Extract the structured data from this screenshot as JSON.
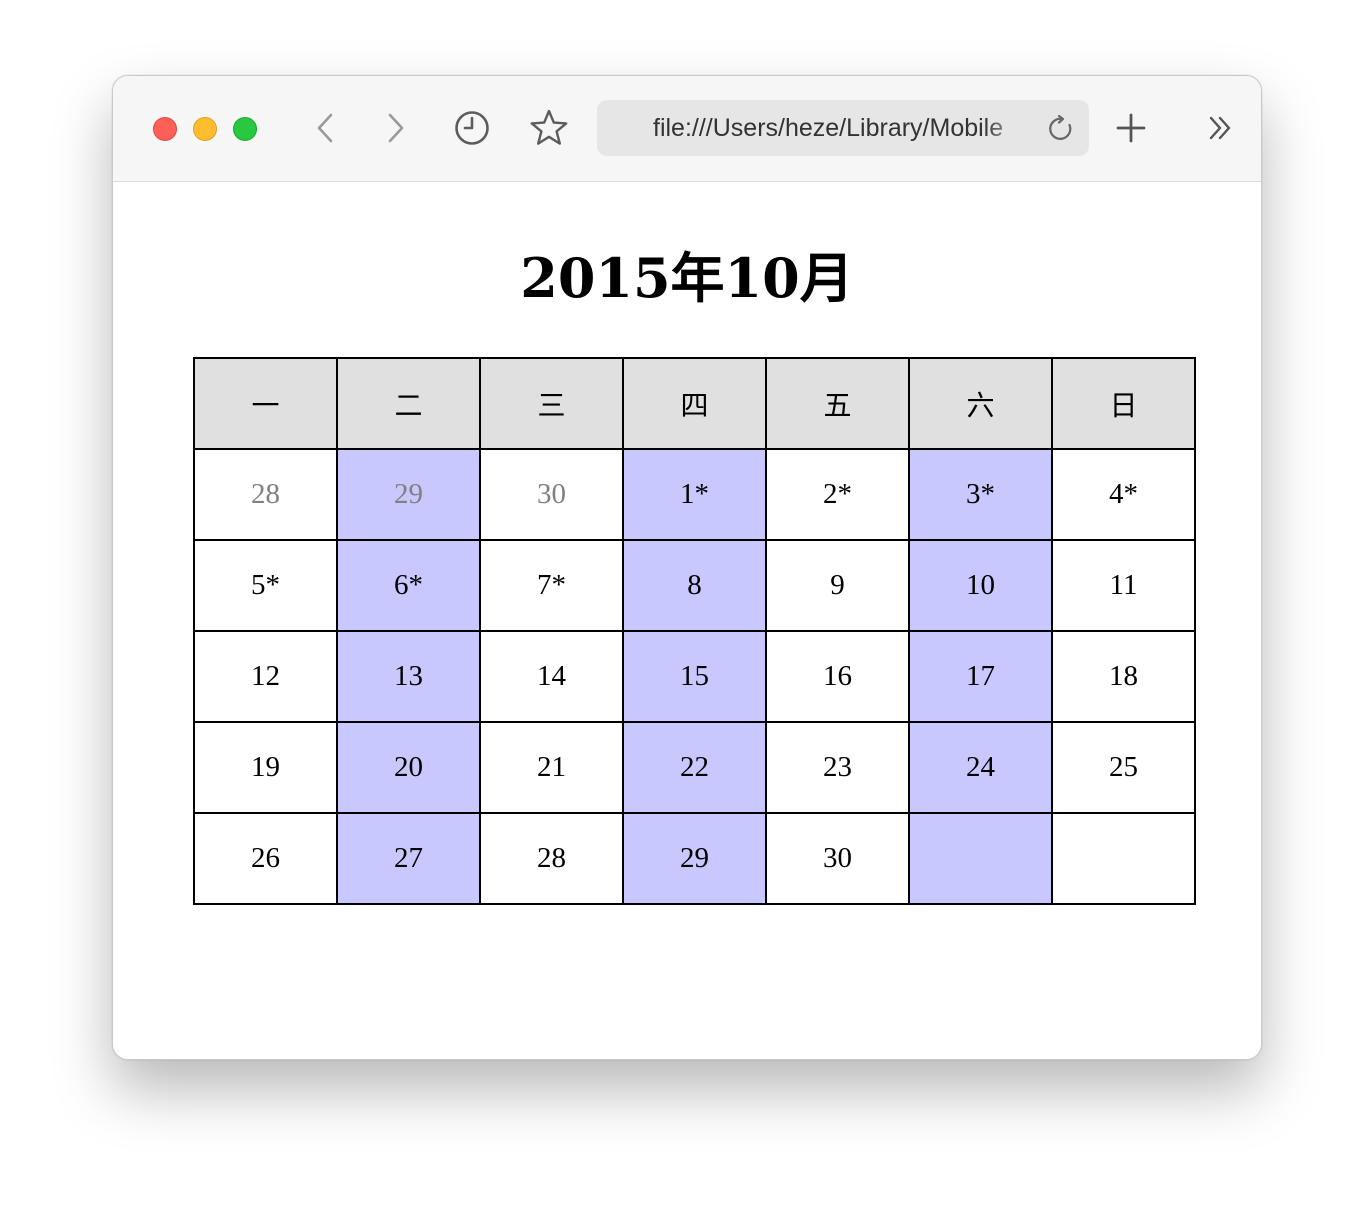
{
  "browser": {
    "url": "file:///Users/heze/Library/Mobile",
    "icons": {
      "back": "chevron-left-icon",
      "forward": "chevron-right-icon",
      "history": "clock-icon",
      "bookmark": "star-icon",
      "reload": "reload-icon",
      "new_tab": "plus-icon",
      "more": "double-chevron-right-icon"
    }
  },
  "calendar": {
    "title": "2015年10月",
    "weekdays": [
      "一",
      "二",
      "三",
      "四",
      "五",
      "六",
      "日"
    ],
    "weeks": [
      [
        "28",
        "29",
        "30",
        "1*",
        "2*",
        "3*",
        "4*"
      ],
      [
        "5*",
        "6*",
        "7*",
        "8",
        "9",
        "10",
        "11"
      ],
      [
        "12",
        "13",
        "14",
        "15",
        "16",
        "17",
        "18"
      ],
      [
        "19",
        "20",
        "21",
        "22",
        "23",
        "24",
        "25"
      ],
      [
        "26",
        "27",
        "28",
        "29",
        "30",
        "",
        ""
      ]
    ],
    "colors": {
      "header_bg": "#e0e0e0",
      "highlight_bg": "#c8c8ff",
      "other_month_text": "#808080"
    }
  }
}
